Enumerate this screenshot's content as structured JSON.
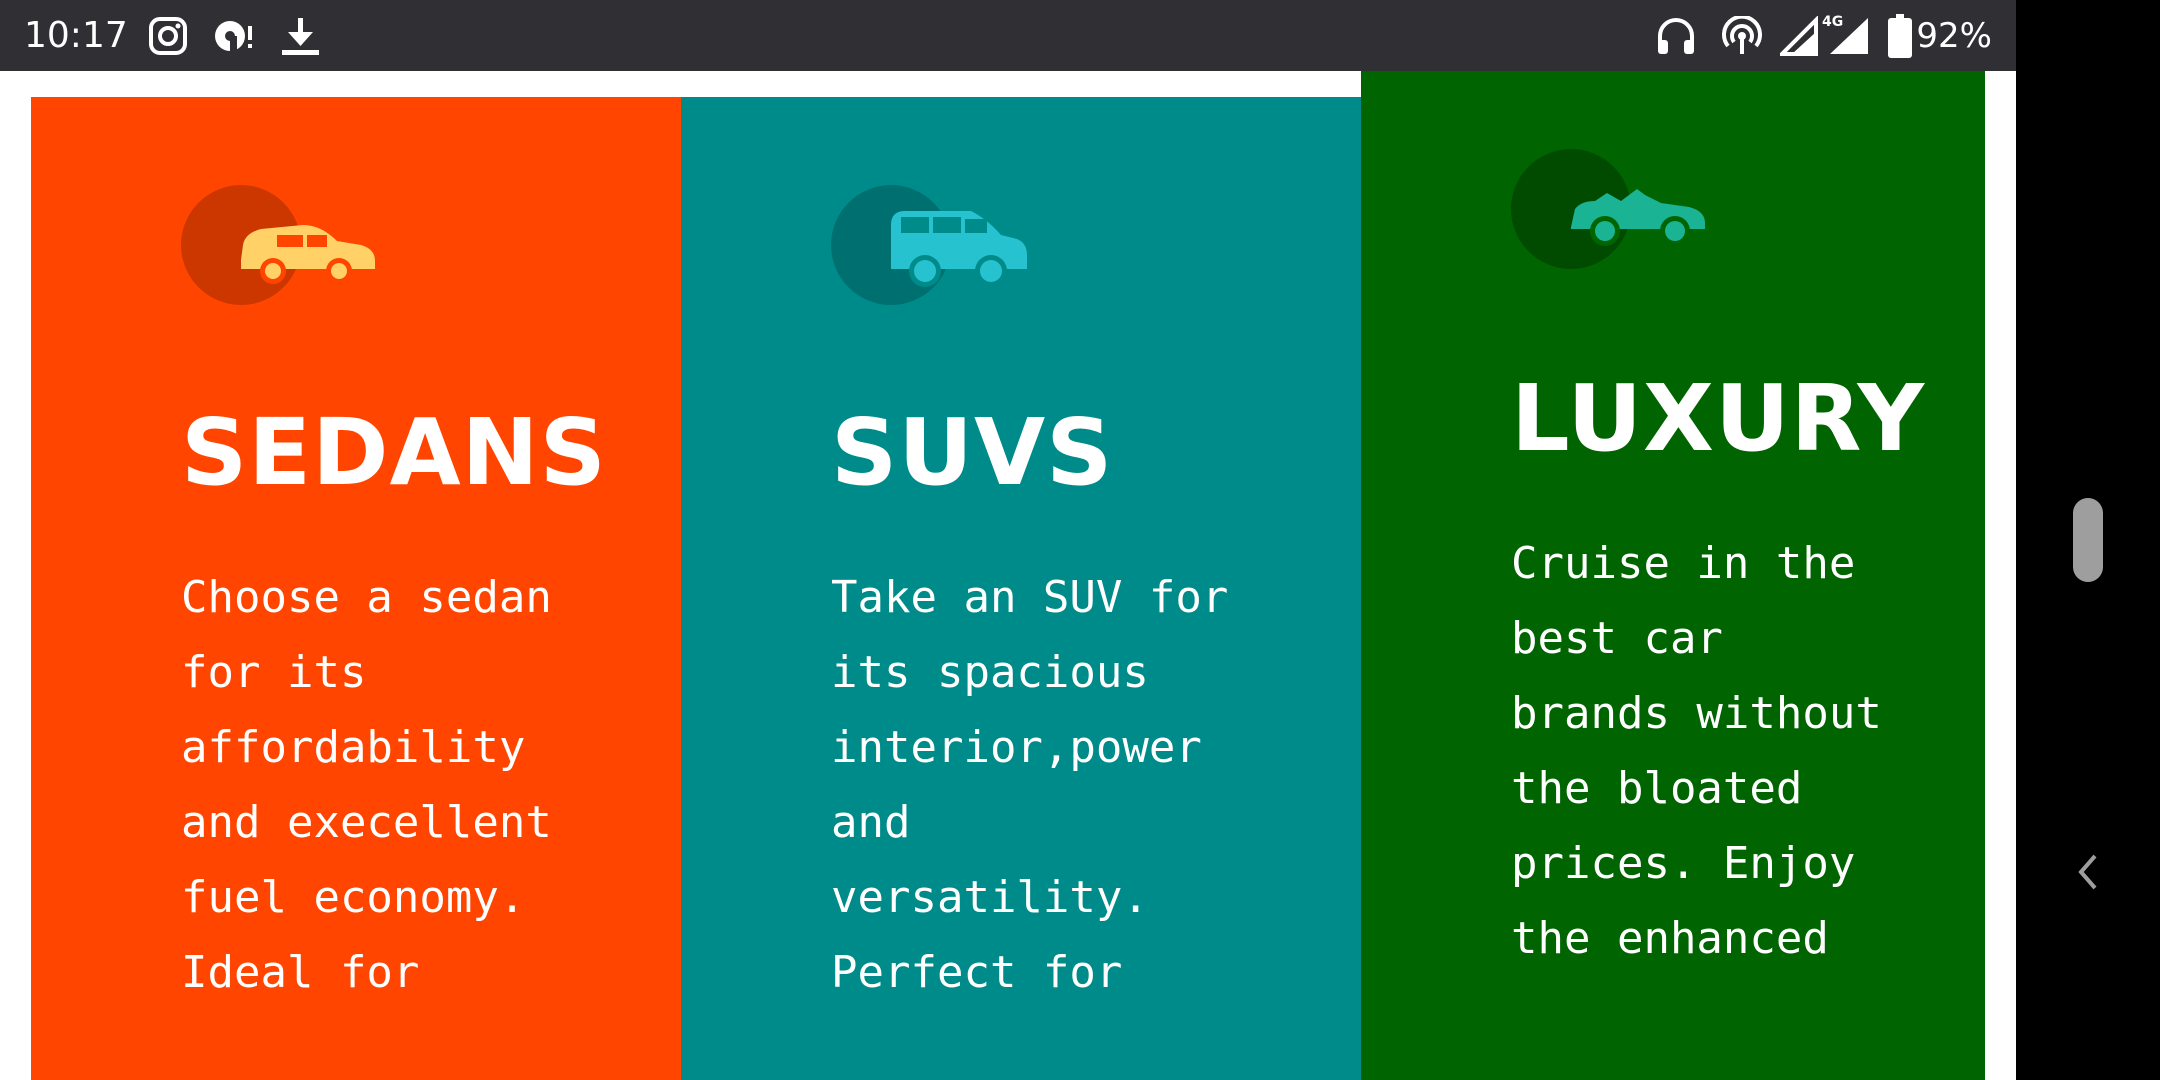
{
  "status_bar": {
    "time": "10:17",
    "battery": "92%",
    "network": "4G",
    "icons": [
      "instagram-icon",
      "podcast-notify-icon",
      "download-icon",
      "headphones-icon",
      "hotspot-icon",
      "signal-icon",
      "signal-4g-icon",
      "battery-icon"
    ]
  },
  "cards": [
    {
      "title": "SEDANS",
      "text": "Choose a sedan for its affordability and execellent fuel economy. Ideal for",
      "color": "#FF4500",
      "icon": "sedan-car-icon",
      "icon_color": "#FFD166"
    },
    {
      "title": "SUVS",
      "text": "Take an SUV for its spacious interior,power and versatility. Perfect for",
      "color": "#008B8B",
      "icon": "suv-car-icon",
      "icon_color": "#27C2CF"
    },
    {
      "title": "LUXURY",
      "text": "Cruise in the best car brands without the bloated prices. Enjoy the enhanced",
      "color": "#006400",
      "icon": "convertible-car-icon",
      "icon_color": "#1AB394"
    }
  ],
  "nav": {
    "icons": [
      "scroll-handle",
      "back-chevron-icon"
    ]
  }
}
